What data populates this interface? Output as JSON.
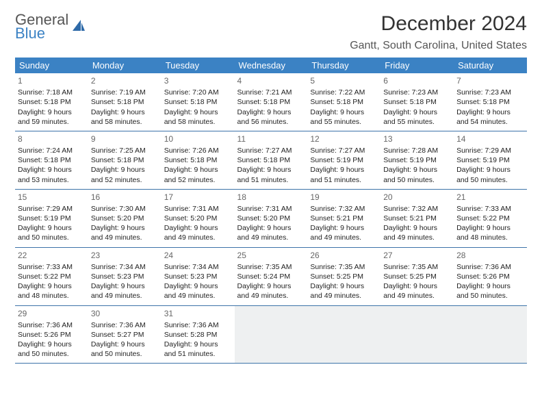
{
  "logo": {
    "line1": "General",
    "line2": "Blue"
  },
  "title": "December 2024",
  "subtitle": "Gantt, South Carolina, United States",
  "weekdays": [
    "Sunday",
    "Monday",
    "Tuesday",
    "Wednesday",
    "Thursday",
    "Friday",
    "Saturday"
  ],
  "labels": {
    "sunrise": "Sunrise:",
    "sunset": "Sunset:",
    "daylight": "Daylight:"
  },
  "days": [
    {
      "n": 1,
      "sunrise": "7:18 AM",
      "sunset": "5:18 PM",
      "daylight": "9 hours and 59 minutes."
    },
    {
      "n": 2,
      "sunrise": "7:19 AM",
      "sunset": "5:18 PM",
      "daylight": "9 hours and 58 minutes."
    },
    {
      "n": 3,
      "sunrise": "7:20 AM",
      "sunset": "5:18 PM",
      "daylight": "9 hours and 58 minutes."
    },
    {
      "n": 4,
      "sunrise": "7:21 AM",
      "sunset": "5:18 PM",
      "daylight": "9 hours and 56 minutes."
    },
    {
      "n": 5,
      "sunrise": "7:22 AM",
      "sunset": "5:18 PM",
      "daylight": "9 hours and 55 minutes."
    },
    {
      "n": 6,
      "sunrise": "7:23 AM",
      "sunset": "5:18 PM",
      "daylight": "9 hours and 55 minutes."
    },
    {
      "n": 7,
      "sunrise": "7:23 AM",
      "sunset": "5:18 PM",
      "daylight": "9 hours and 54 minutes."
    },
    {
      "n": 8,
      "sunrise": "7:24 AM",
      "sunset": "5:18 PM",
      "daylight": "9 hours and 53 minutes."
    },
    {
      "n": 9,
      "sunrise": "7:25 AM",
      "sunset": "5:18 PM",
      "daylight": "9 hours and 52 minutes."
    },
    {
      "n": 10,
      "sunrise": "7:26 AM",
      "sunset": "5:18 PM",
      "daylight": "9 hours and 52 minutes."
    },
    {
      "n": 11,
      "sunrise": "7:27 AM",
      "sunset": "5:18 PM",
      "daylight": "9 hours and 51 minutes."
    },
    {
      "n": 12,
      "sunrise": "7:27 AM",
      "sunset": "5:19 PM",
      "daylight": "9 hours and 51 minutes."
    },
    {
      "n": 13,
      "sunrise": "7:28 AM",
      "sunset": "5:19 PM",
      "daylight": "9 hours and 50 minutes."
    },
    {
      "n": 14,
      "sunrise": "7:29 AM",
      "sunset": "5:19 PM",
      "daylight": "9 hours and 50 minutes."
    },
    {
      "n": 15,
      "sunrise": "7:29 AM",
      "sunset": "5:19 PM",
      "daylight": "9 hours and 50 minutes."
    },
    {
      "n": 16,
      "sunrise": "7:30 AM",
      "sunset": "5:20 PM",
      "daylight": "9 hours and 49 minutes."
    },
    {
      "n": 17,
      "sunrise": "7:31 AM",
      "sunset": "5:20 PM",
      "daylight": "9 hours and 49 minutes."
    },
    {
      "n": 18,
      "sunrise": "7:31 AM",
      "sunset": "5:20 PM",
      "daylight": "9 hours and 49 minutes."
    },
    {
      "n": 19,
      "sunrise": "7:32 AM",
      "sunset": "5:21 PM",
      "daylight": "9 hours and 49 minutes."
    },
    {
      "n": 20,
      "sunrise": "7:32 AM",
      "sunset": "5:21 PM",
      "daylight": "9 hours and 49 minutes."
    },
    {
      "n": 21,
      "sunrise": "7:33 AM",
      "sunset": "5:22 PM",
      "daylight": "9 hours and 48 minutes."
    },
    {
      "n": 22,
      "sunrise": "7:33 AM",
      "sunset": "5:22 PM",
      "daylight": "9 hours and 48 minutes."
    },
    {
      "n": 23,
      "sunrise": "7:34 AM",
      "sunset": "5:23 PM",
      "daylight": "9 hours and 49 minutes."
    },
    {
      "n": 24,
      "sunrise": "7:34 AM",
      "sunset": "5:23 PM",
      "daylight": "9 hours and 49 minutes."
    },
    {
      "n": 25,
      "sunrise": "7:35 AM",
      "sunset": "5:24 PM",
      "daylight": "9 hours and 49 minutes."
    },
    {
      "n": 26,
      "sunrise": "7:35 AM",
      "sunset": "5:25 PM",
      "daylight": "9 hours and 49 minutes."
    },
    {
      "n": 27,
      "sunrise": "7:35 AM",
      "sunset": "5:25 PM",
      "daylight": "9 hours and 49 minutes."
    },
    {
      "n": 28,
      "sunrise": "7:36 AM",
      "sunset": "5:26 PM",
      "daylight": "9 hours and 50 minutes."
    },
    {
      "n": 29,
      "sunrise": "7:36 AM",
      "sunset": "5:26 PM",
      "daylight": "9 hours and 50 minutes."
    },
    {
      "n": 30,
      "sunrise": "7:36 AM",
      "sunset": "5:27 PM",
      "daylight": "9 hours and 50 minutes."
    },
    {
      "n": 31,
      "sunrise": "7:36 AM",
      "sunset": "5:28 PM",
      "daylight": "9 hours and 51 minutes."
    }
  ]
}
